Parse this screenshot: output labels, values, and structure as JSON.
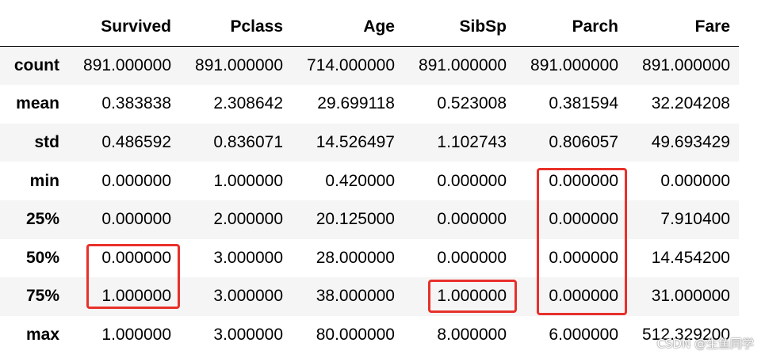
{
  "table": {
    "columns": [
      "",
      "Survived",
      "Pclass",
      "Age",
      "SibSp",
      "Parch",
      "Fare"
    ],
    "rows": [
      {
        "label": "count",
        "values": [
          "891.000000",
          "891.000000",
          "714.000000",
          "891.000000",
          "891.000000",
          "891.000000"
        ]
      },
      {
        "label": "mean",
        "values": [
          "0.383838",
          "2.308642",
          "29.699118",
          "0.523008",
          "0.381594",
          "32.204208"
        ]
      },
      {
        "label": "std",
        "values": [
          "0.486592",
          "0.836071",
          "14.526497",
          "1.102743",
          "0.806057",
          "49.693429"
        ]
      },
      {
        "label": "min",
        "values": [
          "0.000000",
          "1.000000",
          "0.420000",
          "0.000000",
          "0.000000",
          "0.000000"
        ]
      },
      {
        "label": "25%",
        "values": [
          "0.000000",
          "2.000000",
          "20.125000",
          "0.000000",
          "0.000000",
          "7.910400"
        ]
      },
      {
        "label": "50%",
        "values": [
          "0.000000",
          "3.000000",
          "28.000000",
          "0.000000",
          "0.000000",
          "14.454200"
        ]
      },
      {
        "label": "75%",
        "values": [
          "1.000000",
          "3.000000",
          "38.000000",
          "1.000000",
          "0.000000",
          "31.000000"
        ]
      },
      {
        "label": "max",
        "values": [
          "1.000000",
          "3.000000",
          "80.000000",
          "8.000000",
          "6.000000",
          "512.329200"
        ]
      }
    ]
  },
  "highlight_color": "#e8302a",
  "watermark": "CSDN @生鱼同学"
}
